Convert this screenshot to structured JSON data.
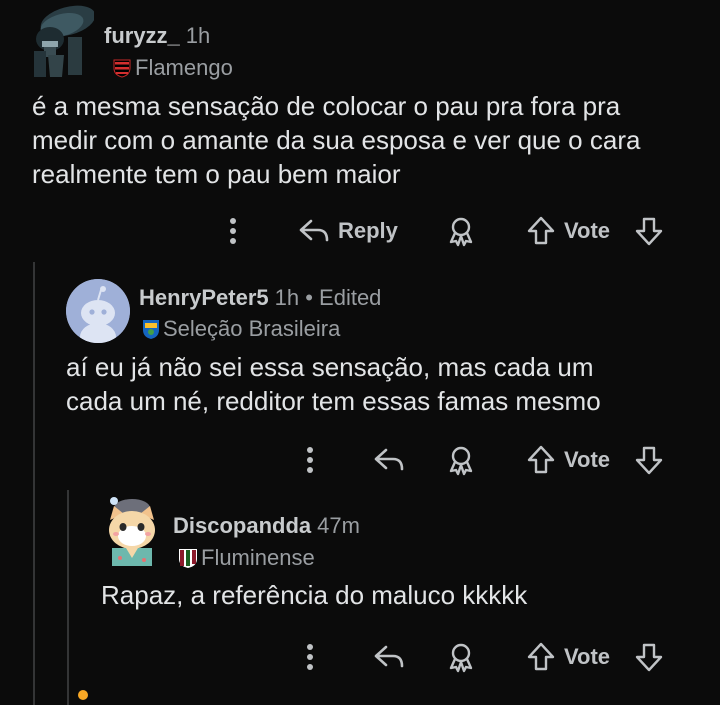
{
  "comments": [
    {
      "username": "furyzz_",
      "time": "1h",
      "flair": "Flamengo",
      "body": [
        "é a mesma sensação de colocar o pau pra fora pra",
        "medir com o amante da sua esposa e ver que o cara",
        "realmente tem o pau bem maior"
      ],
      "reply_label": "Reply",
      "vote_label": "Vote"
    },
    {
      "username": "HenryPeter5",
      "time": "1h • Edited",
      "flair": "Seleção Brasileira",
      "body": [
        "aí eu já não sei essa sensação, mas cada um",
        "cada um né, redditor tem essas famas mesmo"
      ],
      "vote_label": "Vote"
    },
    {
      "username": "Discopandda",
      "time": "47m",
      "flair": "Fluminense",
      "body": [
        "Rapaz, a referência do maluco kkkkk"
      ],
      "vote_label": "Vote"
    }
  ],
  "icons": {
    "more": "more-options-icon",
    "reply": "reply-arrow-icon",
    "award": "award-icon",
    "upvote": "upvote-arrow-icon",
    "downvote": "downvote-arrow-icon"
  },
  "colors": {
    "background": "#0b0b0b",
    "text": "#e2e4e6",
    "muted": "#9a9ea2",
    "thread_line": "#343536"
  }
}
